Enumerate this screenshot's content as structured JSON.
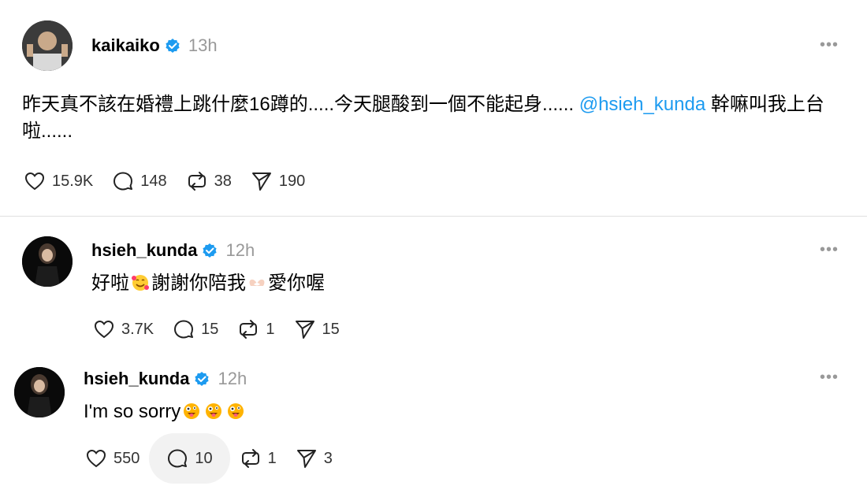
{
  "posts": [
    {
      "username": "kaikaiko",
      "time": "13h",
      "text_before": "昨天真不該在婚禮上跳什麼16蹲的.....今天腿酸到一個不能起身......",
      "mention": "@hsieh_kunda",
      "text_after": "幹嘛叫我上台啦......",
      "likes": "15.9K",
      "comments": "148",
      "reposts": "38",
      "shares": "190"
    },
    {
      "username": "hsieh_kunda",
      "time": "12h",
      "text_part1": "好啦",
      "text_part2": "謝謝你陪我",
      "text_part3": "愛你喔",
      "likes": "3.7K",
      "comments": "15",
      "reposts": "1",
      "shares": "15"
    },
    {
      "username": "hsieh_kunda",
      "time": "12h",
      "text": "I'm so sorry",
      "likes": "550",
      "comments": "10",
      "reposts": "1",
      "shares": "3"
    }
  ],
  "icons": {
    "verified": "verified-badge-icon",
    "like": "heart-icon",
    "comment": "comment-bubble-icon",
    "repost": "repost-icon",
    "share": "send-icon",
    "more": "more-dots-icon"
  },
  "colors": {
    "mention": "#1d9bf0",
    "verified": "#1d9bf0",
    "time": "#999999"
  }
}
